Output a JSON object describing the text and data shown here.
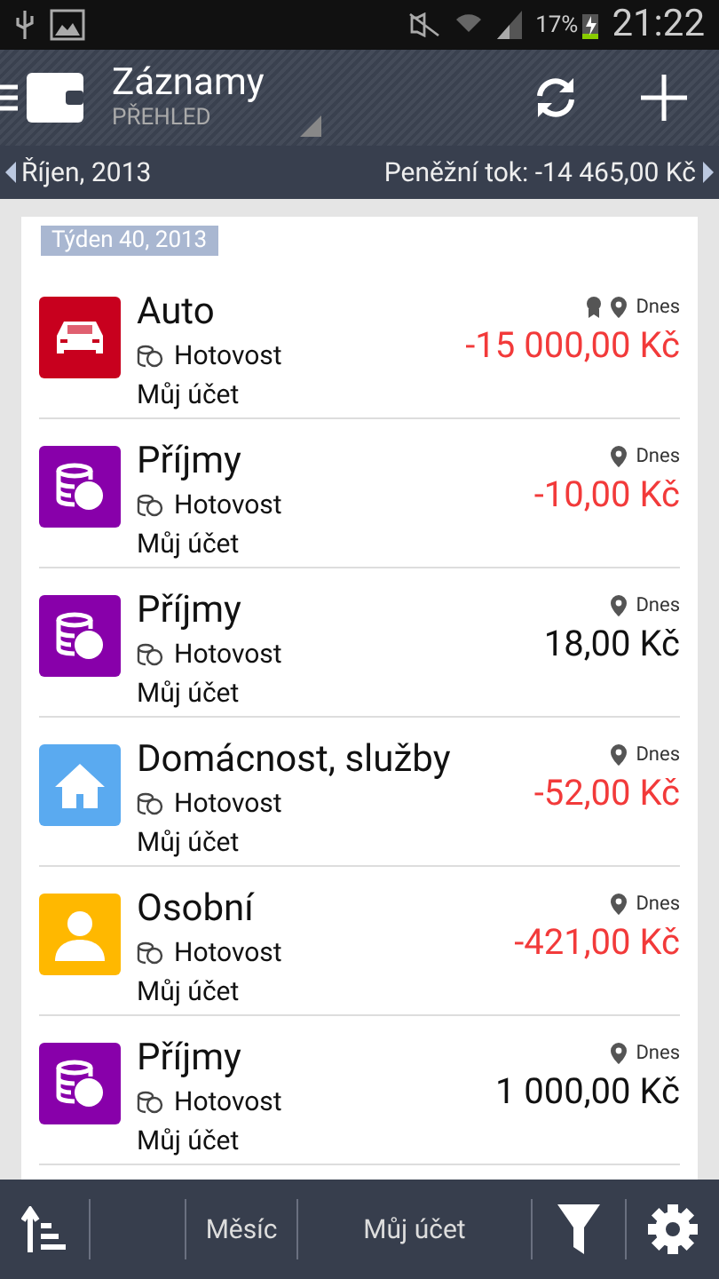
{
  "status_bar": {
    "battery_percent": "17%",
    "time": "21:22"
  },
  "header": {
    "title": "Záznamy",
    "subtitle": "PŘEHLED"
  },
  "period_bar": {
    "period": "Říjen, 2013",
    "cash_flow": "Peněžní tok: -14 465,00 Kč"
  },
  "week_label": "Týden 40, 2013",
  "records": [
    {
      "category": "Auto",
      "kind": "car",
      "color": "#c8001e",
      "payment": "Hotovost",
      "account": "Můj účet",
      "award": true,
      "date": "Dnes",
      "amount": "-15 000,00 Kč",
      "expense": true
    },
    {
      "category": "Příjmy",
      "kind": "coins",
      "color": "#8800aa",
      "payment": "Hotovost",
      "account": "Můj účet",
      "award": false,
      "date": "Dnes",
      "amount": "-10,00 Kč",
      "expense": true
    },
    {
      "category": "Příjmy",
      "kind": "coins",
      "color": "#8800aa",
      "payment": "Hotovost",
      "account": "Můj účet",
      "award": false,
      "date": "Dnes",
      "amount": "18,00 Kč",
      "expense": false
    },
    {
      "category": "Domácnost, služby",
      "kind": "house",
      "color": "#5aaaf0",
      "payment": "Hotovost",
      "account": "Můj účet",
      "award": false,
      "date": "Dnes",
      "amount": "-52,00 Kč",
      "expense": true
    },
    {
      "category": "Osobní",
      "kind": "person",
      "color": "#ffb800",
      "payment": "Hotovost",
      "account": "Můj účet",
      "award": false,
      "date": "Dnes",
      "amount": "-421,00 Kč",
      "expense": true
    },
    {
      "category": "Příjmy",
      "kind": "coins",
      "color": "#8800aa",
      "payment": "Hotovost",
      "account": "Můj účet",
      "award": false,
      "date": "Dnes",
      "amount": "1 000,00 Kč",
      "expense": false
    }
  ],
  "bottom_bar": {
    "period_filter": "Měsíc",
    "account_filter": "Můj účet"
  }
}
